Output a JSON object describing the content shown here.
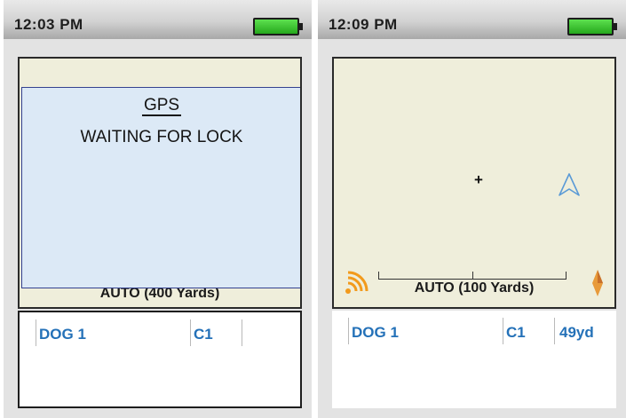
{
  "left_screen": {
    "status_bar": {
      "time": "12:03 PM",
      "battery_level": 1.0
    },
    "gps_overlay": {
      "title": "GPS",
      "message": "WAITING FOR LOCK"
    },
    "scale_label": "AUTO (400 Yards)",
    "dog_info": {
      "name": "DOG 1",
      "channel": "C1",
      "distance": ""
    }
  },
  "right_screen": {
    "status_bar": {
      "time": "12:09 PM",
      "battery_level": 1.0
    },
    "scale_label": "AUTO (100 Yards)",
    "dog_info": {
      "name": "DOG 1",
      "channel": "C1",
      "distance": "49yd"
    }
  },
  "icons": {
    "signal": "signal-strength-icon",
    "compass": "compass-icon",
    "position": "crosshair-icon",
    "dog_direction": "navigation-arrow-icon",
    "battery": "battery-icon"
  },
  "colors": {
    "map_background": "#efeedb",
    "overlay_background": "#dce9f6",
    "overlay_border": "#34418f",
    "battery_fill": "#3ccf2e",
    "dog_text": "#2471b8",
    "signal_icon": "#f29a1c",
    "compass_icon": "#e89a3a",
    "nav_arrow": "#5a9ad6"
  }
}
